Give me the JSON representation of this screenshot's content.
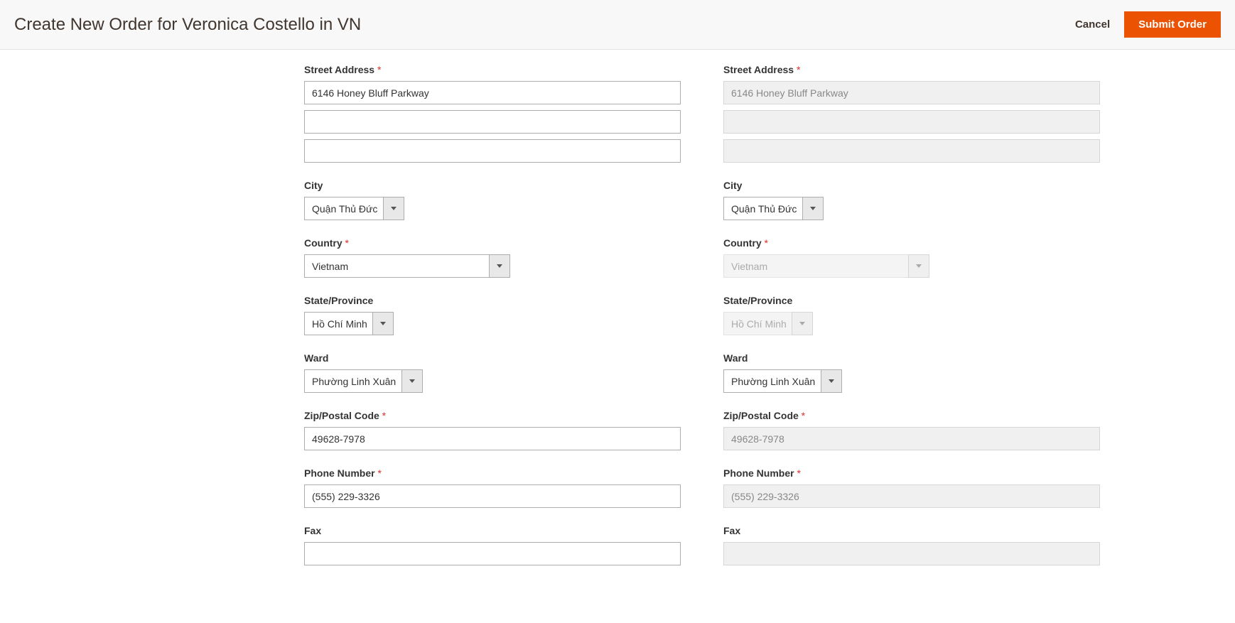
{
  "header": {
    "title": "Create New Order for Veronica Costello in VN",
    "cancel": "Cancel",
    "submit": "Submit Order"
  },
  "labels": {
    "street": "Street Address",
    "city": "City",
    "country": "Country",
    "state": "State/Province",
    "ward": "Ward",
    "zip": "Zip/Postal Code",
    "phone": "Phone Number",
    "fax": "Fax"
  },
  "billing": {
    "street1": "6146 Honey Bluff Parkway",
    "street2": "",
    "street3": "",
    "city": "Quận Thủ Đức",
    "country": "Vietnam",
    "state": "Hồ Chí Minh",
    "ward": "Phường Linh Xuân",
    "zip": "49628-7978",
    "phone": "(555) 229-3326",
    "fax": ""
  },
  "shipping": {
    "street1": "6146 Honey Bluff Parkway",
    "street2": "",
    "street3": "",
    "city": "Quận Thủ Đức",
    "country": "Vietnam",
    "state": "Hồ Chí Minh",
    "ward": "Phường Linh Xuân",
    "zip": "49628-7978",
    "phone": "(555) 229-3326",
    "fax": ""
  }
}
